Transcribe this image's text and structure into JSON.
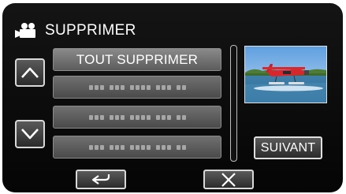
{
  "header": {
    "title": "SUPPRIMER",
    "mode_icon": "video-camera-icon"
  },
  "navigation": {
    "up_icon": "chevron-up-icon",
    "down_icon": "chevron-down-icon"
  },
  "list": {
    "items": [
      {
        "label": "TOUT SUPPRIMER",
        "kind": "action"
      },
      {
        "label": "",
        "kind": "blurred-entry"
      },
      {
        "label": "",
        "kind": "blurred-entry"
      },
      {
        "label": "",
        "kind": "blurred-entry"
      }
    ]
  },
  "preview": {
    "icon": "seaplane-thumbnail-image"
  },
  "buttons": {
    "next_label": "SUIVANT",
    "back_icon": "return-arrow-icon",
    "close_icon": "close-x-icon"
  },
  "colors": {
    "screen_background": "#0a0a0a",
    "button_fill": "#4a4a4a",
    "button_border": "#d8d8d8",
    "text": "#ffffff"
  }
}
